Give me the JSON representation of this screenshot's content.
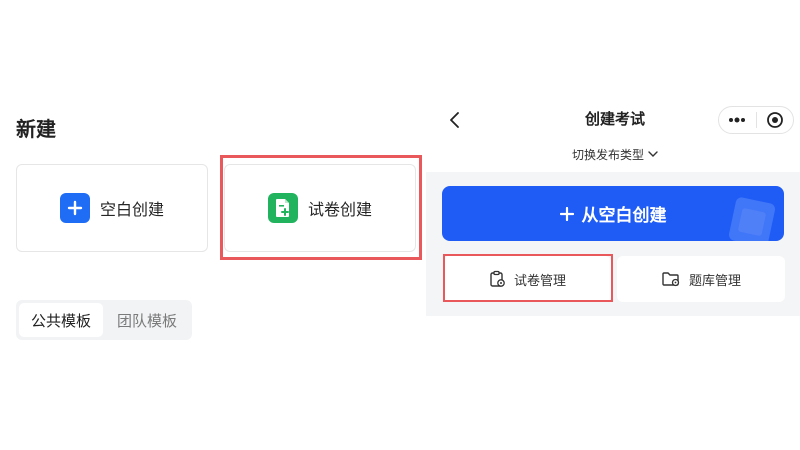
{
  "left": {
    "title": "新建",
    "cards": [
      {
        "label": "空白创建",
        "icon": "plus-icon",
        "color": "#1f6df5"
      },
      {
        "label": "试卷创建",
        "icon": "document-add-icon",
        "color": "#22b35e"
      }
    ],
    "tabs": [
      {
        "label": "公共模板",
        "active": true
      },
      {
        "label": "团队模板",
        "active": false
      }
    ]
  },
  "mobile": {
    "nav_title": "创建考试",
    "switch_label": "切换发布类型",
    "primary_button": "从空白创建",
    "primary_color": "#1f5cf5",
    "shortcuts": [
      {
        "label": "试卷管理",
        "icon": "clipboard-gear-icon"
      },
      {
        "label": "题库管理",
        "icon": "folder-gear-icon"
      }
    ]
  },
  "highlight_color": "#e9585a"
}
